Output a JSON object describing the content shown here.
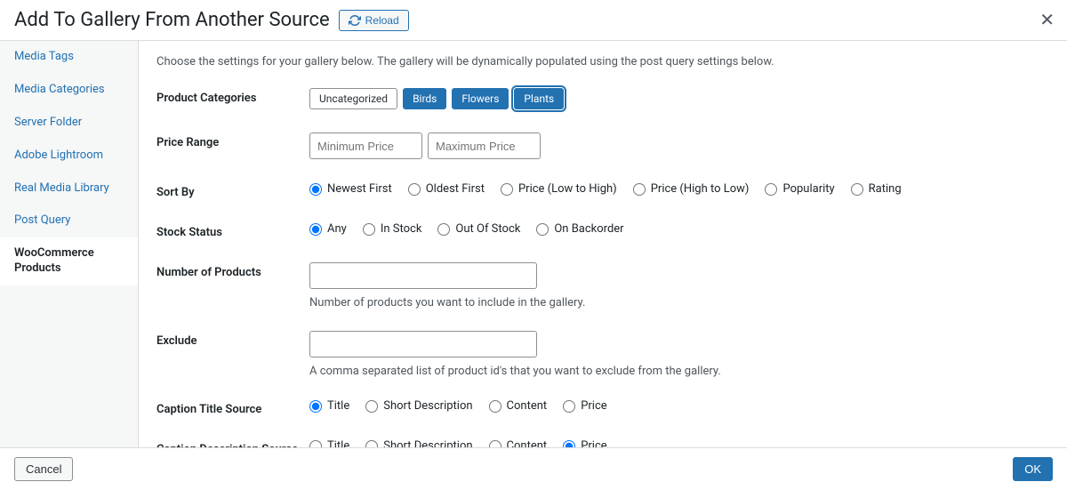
{
  "header": {
    "title": "Add To Gallery From Another Source",
    "reload_label": "Reload"
  },
  "sidebar": {
    "items": [
      {
        "label": "Media Tags"
      },
      {
        "label": "Media Categories"
      },
      {
        "label": "Server Folder"
      },
      {
        "label": "Adobe Lightroom"
      },
      {
        "label": "Real Media Library"
      },
      {
        "label": "Post Query"
      },
      {
        "label": "WooCommerce Products"
      }
    ],
    "active_index": 6
  },
  "intro": "Choose the settings for your gallery below. The gallery will be dynamically populated using the post query settings below.",
  "labels": {
    "product_categories": "Product Categories",
    "price_range": "Price Range",
    "sort_by": "Sort By",
    "stock_status": "Stock Status",
    "number_of_products": "Number of Products",
    "exclude": "Exclude",
    "caption_title_source": "Caption Title Source",
    "caption_description_source": "Caption Description Source"
  },
  "product_categories": {
    "chips": [
      "Uncategorized",
      "Birds",
      "Flowers",
      "Plants"
    ],
    "selected_indexes": [
      1,
      2,
      3
    ],
    "focused_index": 3
  },
  "price_range": {
    "min_placeholder": "Minimum Price",
    "max_placeholder": "Maximum Price",
    "min_value": "",
    "max_value": ""
  },
  "sort_by": {
    "options": [
      "Newest First",
      "Oldest First",
      "Price (Low to High)",
      "Price (High to Low)",
      "Popularity",
      "Rating"
    ],
    "selected_index": 0
  },
  "stock_status": {
    "options": [
      "Any",
      "In Stock",
      "Out Of Stock",
      "On Backorder"
    ],
    "selected_index": 0
  },
  "number_of_products": {
    "value": "",
    "help": "Number of products you want to include in the gallery."
  },
  "exclude": {
    "value": "",
    "help": "A comma separated list of product id's that you want to exclude from the gallery."
  },
  "caption_title_source": {
    "options": [
      "Title",
      "Short Description",
      "Content",
      "Price"
    ],
    "selected_index": 0
  },
  "caption_description_source": {
    "options": [
      "Title",
      "Short Description",
      "Content",
      "Price"
    ],
    "selected_index": 3
  },
  "footer": {
    "cancel_label": "Cancel",
    "ok_label": "OK"
  }
}
